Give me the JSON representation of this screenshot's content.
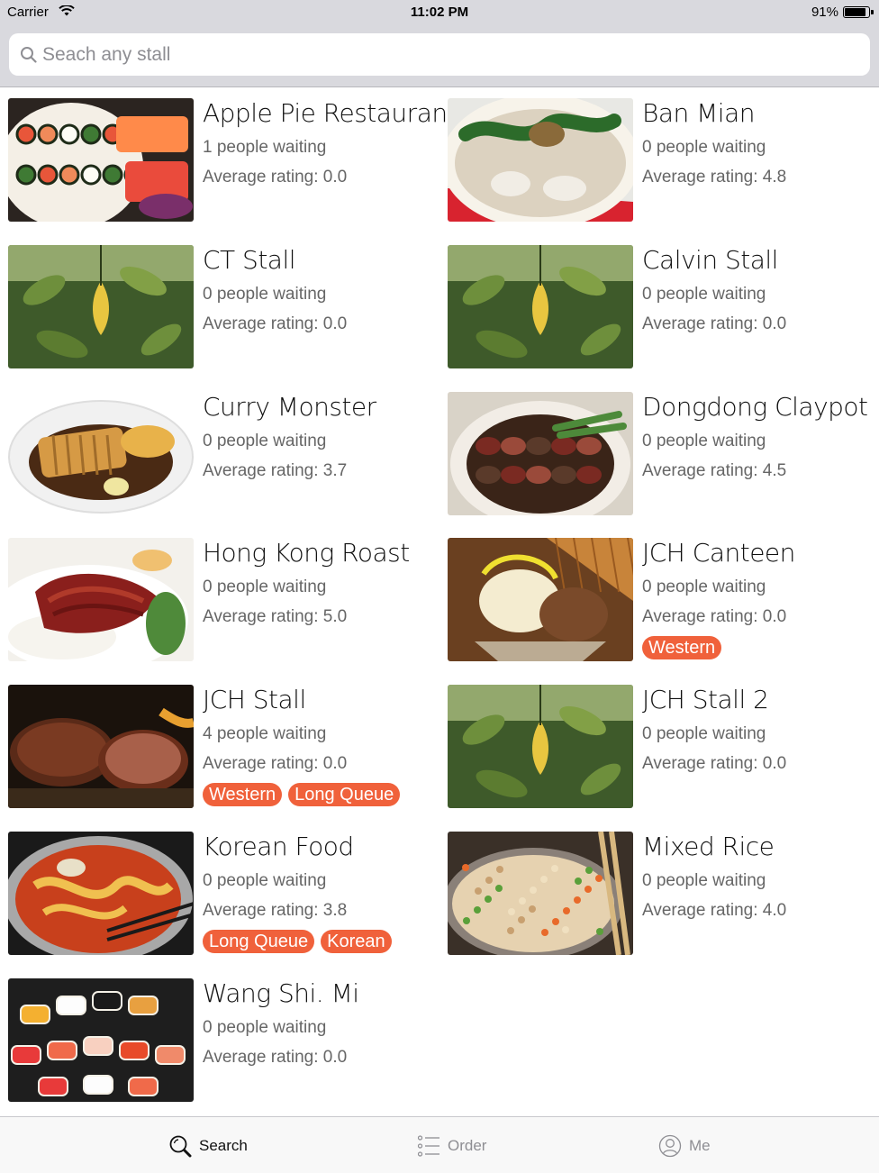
{
  "status_bar": {
    "carrier": "Carrier",
    "time": "11:02 PM",
    "battery": "91%"
  },
  "search": {
    "placeholder": "Seach any stall",
    "value": ""
  },
  "stalls": [
    {
      "name": "Apple Pie Restaurant",
      "waiting": "1 people waiting",
      "rating": "Average rating: 0.0",
      "tags": [],
      "image": "sushi-platter"
    },
    {
      "name": "Ban Mian",
      "waiting": "0 people waiting",
      "rating": "Average rating: 4.8",
      "tags": [],
      "image": "noodle-soup"
    },
    {
      "name": "CT Stall",
      "waiting": "0 people waiting",
      "rating": "Average rating: 0.0",
      "tags": [],
      "image": "plant-leaves"
    },
    {
      "name": "Calvin Stall",
      "waiting": "0 people waiting",
      "rating": "Average rating: 0.0",
      "tags": [],
      "image": "plant-leaves"
    },
    {
      "name": "Curry Monster",
      "waiting": "0 people waiting",
      "rating": "Average rating: 3.7",
      "tags": [],
      "image": "katsu-curry"
    },
    {
      "name": "Dongdong Claypot",
      "waiting": "0 people waiting",
      "rating": "Average rating: 4.5",
      "tags": [],
      "image": "claypot-rice"
    },
    {
      "name": "Hong Kong Roast",
      "waiting": "0 people waiting",
      "rating": "Average rating: 5.0",
      "tags": [],
      "image": "roast-duck"
    },
    {
      "name": "JCH Canteen",
      "waiting": "0 people waiting",
      "rating": "Average rating: 0.0",
      "tags": [
        "Western"
      ],
      "image": "ice-cream"
    },
    {
      "name": "JCH Stall",
      "waiting": "4 people waiting",
      "rating": "Average rating: 0.0",
      "tags": [
        "Western",
        "Long Queue"
      ],
      "image": "steak"
    },
    {
      "name": "JCH Stall 2",
      "waiting": "0 people waiting",
      "rating": "Average rating: 0.0",
      "tags": [],
      "image": "plant-leaves"
    },
    {
      "name": "Korean Food",
      "waiting": "0 people waiting",
      "rating": "Average rating: 3.8",
      "tags": [
        "Long Queue",
        "Korean"
      ],
      "image": "korean-stew"
    },
    {
      "name": "Mixed Rice",
      "waiting": "0 people waiting",
      "rating": "Average rating: 4.0",
      "tags": [],
      "image": "fried-rice"
    },
    {
      "name": "Wang Shi. Mi",
      "waiting": "0 people waiting",
      "rating": "Average rating: 0.0",
      "tags": [],
      "image": "sushi-nigiri"
    }
  ],
  "tab_bar": {
    "search": "Search",
    "order": "Order",
    "me": "Me",
    "active": "search"
  },
  "colors": {
    "tag_bg": "#f0613b",
    "header_bg": "#d9d9de"
  }
}
